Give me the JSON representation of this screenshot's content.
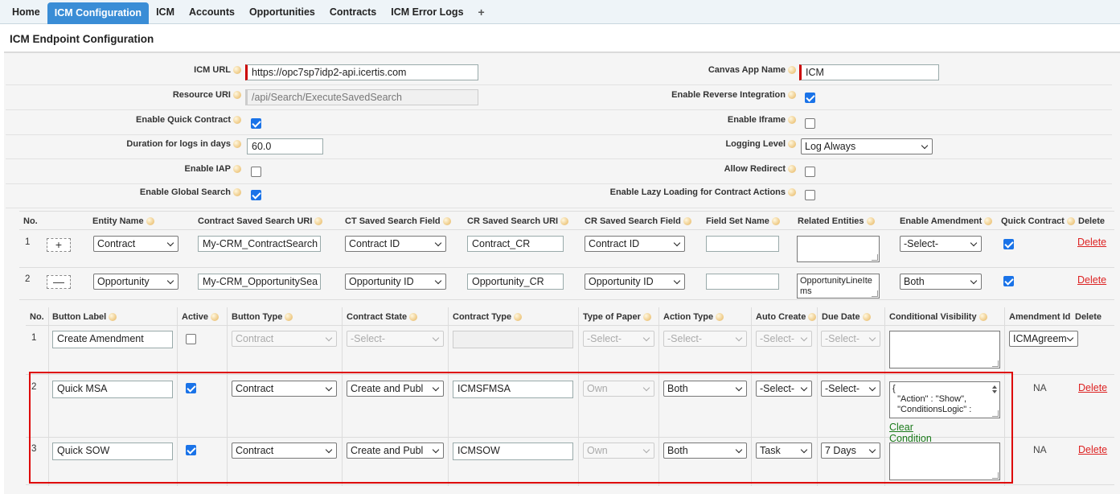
{
  "tabs": [
    {
      "label": "Home",
      "active": false
    },
    {
      "label": "ICM Configuration",
      "active": true
    },
    {
      "label": "ICM",
      "active": false
    },
    {
      "label": "Accounts",
      "active": false
    },
    {
      "label": "Opportunities",
      "active": false
    },
    {
      "label": "Contracts",
      "active": false
    },
    {
      "label": "ICM Error Logs",
      "active": false
    },
    {
      "label": "+",
      "active": false
    }
  ],
  "page_title": "ICM Endpoint Configuration",
  "config": {
    "icm_url": {
      "label": "ICM URL",
      "value": "https://opc7sp7idp2-api.icertis.com"
    },
    "canvas_app_name": {
      "label": "Canvas App Name",
      "value": "ICM"
    },
    "resource_uri": {
      "label": "Resource URI",
      "value": "/api/Search/ExecuteSavedSearch"
    },
    "enable_reverse_integration": {
      "label": "Enable Reverse Integration",
      "checked": true
    },
    "enable_quick_contract": {
      "label": "Enable Quick Contract",
      "checked": true
    },
    "enable_iframe": {
      "label": "Enable Iframe",
      "checked": false
    },
    "duration_logs": {
      "label": "Duration for logs in days",
      "value": "60.0"
    },
    "logging_level": {
      "label": "Logging Level",
      "value": "Log Always"
    },
    "enable_iap": {
      "label": "Enable IAP",
      "checked": false
    },
    "allow_redirect": {
      "label": "Allow Redirect",
      "checked": false
    },
    "enable_global_search": {
      "label": "Enable Global Search",
      "checked": true
    },
    "enable_lazy_loading": {
      "label": "Enable Lazy Loading for Contract Actions",
      "checked": false
    }
  },
  "entity_table": {
    "headers": [
      "No.",
      "Entity Name",
      "Contract Saved Search URI",
      "CT Saved Search Field",
      "CR Saved Search URI",
      "CR Saved Search Field",
      "Field Set Name",
      "Related Entities",
      "Enable Amendment",
      "Quick Contract",
      "Delete"
    ],
    "rows": [
      {
        "no": "1",
        "toggle": "+",
        "entity": "Contract",
        "ct_uri": "My-CRM_ContractSearch",
        "ct_field": "Contract ID",
        "cr_uri": "Contract_CR",
        "cr_field": "Contract ID",
        "field_set": "",
        "related": "",
        "amendment": "-Select-",
        "quick": true,
        "delete": "Delete"
      },
      {
        "no": "2",
        "toggle": "—",
        "entity": "Opportunity",
        "ct_uri": "My-CRM_OpportunitySea",
        "ct_field": "Opportunity ID",
        "cr_uri": "Opportunity_CR",
        "cr_field": "Opportunity ID",
        "field_set": "",
        "related": "OpportunityLineItems",
        "amendment": "Both",
        "quick": true,
        "delete": "Delete"
      }
    ]
  },
  "button_table": {
    "headers": [
      "No.",
      "Button Label",
      "Active",
      "Button Type",
      "Contract State",
      "Contract Type",
      "Type of Paper",
      "Action Type",
      "Auto Create",
      "Due Date",
      "Conditional Visibility",
      "Amendment Id",
      "Delete"
    ],
    "rows": [
      {
        "no": "1",
        "label": "Create Amendment",
        "active": false,
        "button_type": "Contract",
        "state": "-Select-",
        "ctype": "",
        "paper": "-Select-",
        "action": "-Select-",
        "auto": "-Select-",
        "due": "-Select-",
        "cond": "",
        "amend": "ICMAgreem",
        "delete": ""
      },
      {
        "no": "2",
        "label": "Quick MSA",
        "active": true,
        "button_type": "Contract",
        "state": "Create and Publ",
        "ctype": "ICMSFMSA",
        "paper": "Own",
        "action": "Both",
        "auto": "-Select-",
        "due": "-Select-",
        "cond": "{\n  \"Action\" : \"Show\",\n  \"ConditionsLogic\" :",
        "amend": "NA",
        "delete": "Delete",
        "clear": "Clear Condition"
      },
      {
        "no": "3",
        "label": "Quick SOW",
        "active": true,
        "button_type": "Contract",
        "state": "Create and Publ",
        "ctype": "ICMSOW",
        "paper": "Own",
        "action": "Both",
        "auto": "Task",
        "due": "7 Days",
        "cond": "",
        "amend": "NA",
        "delete": "Delete"
      }
    ]
  }
}
